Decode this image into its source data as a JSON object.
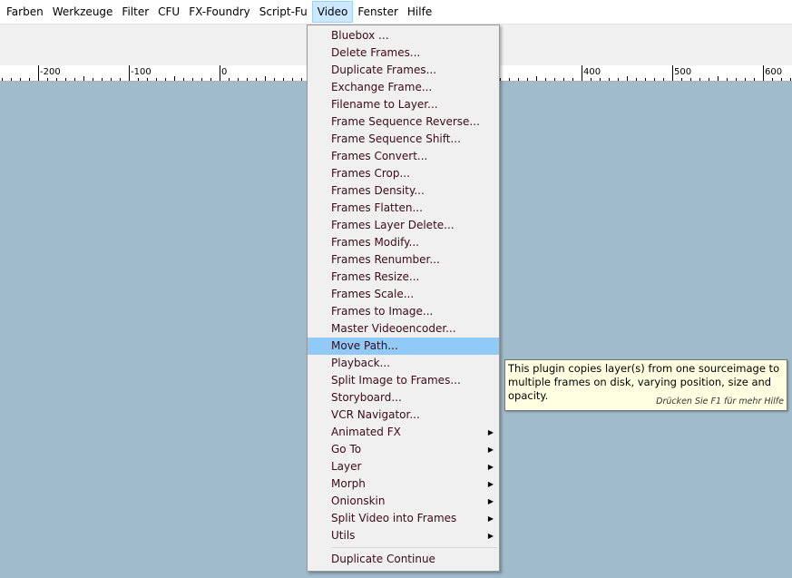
{
  "menubar": [
    "Farben",
    "Werkzeuge",
    "Filter",
    "CFU",
    "FX-Foundry",
    "Script-Fu",
    "Video",
    "Fenster",
    "Hilfe"
  ],
  "active_menu": "Video",
  "ruler": {
    "labels": [
      "-200",
      "-100",
      "0",
      "400",
      "500",
      "600"
    ]
  },
  "video_menu": {
    "items": [
      {
        "label": "Bluebox ..."
      },
      {
        "label": "Delete Frames..."
      },
      {
        "label": "Duplicate Frames..."
      },
      {
        "label": "Exchange Frame..."
      },
      {
        "label": "Filename to Layer..."
      },
      {
        "label": "Frame Sequence Reverse..."
      },
      {
        "label": "Frame Sequence Shift..."
      },
      {
        "label": "Frames Convert..."
      },
      {
        "label": "Frames Crop..."
      },
      {
        "label": "Frames Density..."
      },
      {
        "label": "Frames Flatten..."
      },
      {
        "label": "Frames Layer Delete..."
      },
      {
        "label": "Frames Modify..."
      },
      {
        "label": "Frames Renumber..."
      },
      {
        "label": "Frames Resize..."
      },
      {
        "label": "Frames Scale..."
      },
      {
        "label": "Frames to Image..."
      },
      {
        "label": "Master Videoencoder..."
      },
      {
        "label": "Move Path...",
        "highlighted": true
      },
      {
        "label": "Playback..."
      },
      {
        "label": "Split Image to Frames..."
      },
      {
        "label": "Storyboard..."
      },
      {
        "label": "VCR Navigator..."
      },
      {
        "label": "Animated FX",
        "submenu": true
      },
      {
        "label": "Go To",
        "submenu": true
      },
      {
        "label": "Layer",
        "submenu": true
      },
      {
        "label": "Morph",
        "submenu": true
      },
      {
        "label": "Onionskin",
        "submenu": true
      },
      {
        "label": "Split Video into Frames",
        "submenu": true
      },
      {
        "label": "Utils",
        "submenu": true
      }
    ],
    "footer_item": "Duplicate Continue"
  },
  "tooltip": {
    "text": "This plugin copies layer(s) from one sourceimage to multiple frames on disk, varying position, size and opacity.",
    "hint": "Drücken Sie F1 für mehr Hilfe"
  }
}
